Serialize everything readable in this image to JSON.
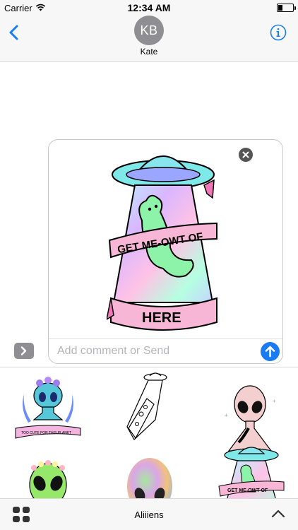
{
  "status": {
    "carrier": "Carrier",
    "time": "12:34 AM"
  },
  "header": {
    "avatar_initials": "KB",
    "contact_name": "Kate"
  },
  "preview": {
    "sticker_text_top": "GET ME-OWT OF",
    "sticker_text_bottom": "HERE",
    "comment_placeholder": "Add comment or Send"
  },
  "drawer": {
    "stickers": [
      {
        "name": "alien-bust-sticker",
        "caption": "TOO CUTE FOR THIS PLANET"
      },
      {
        "name": "ufo-pizza-sticker"
      },
      {
        "name": "pink-alien-sticker"
      },
      {
        "name": "green-alien-flower-crown-sticker"
      },
      {
        "name": "rainbow-alien-sticker"
      },
      {
        "name": "ufo-cat-sticker",
        "caption": "GET ME-OWT OF"
      }
    ]
  },
  "bottom_bar": {
    "pack_name": "Aliiiens"
  },
  "colors": {
    "accent": "#1a7cf5",
    "bar_bg": "#f7f7f7",
    "avatar_bg": "#8e8e93",
    "placeholder": "#b5b5ba"
  },
  "icons": [
    "wifi-icon",
    "battery-icon",
    "back-chevron-icon",
    "info-icon",
    "close-icon",
    "send-arrow-icon",
    "expand-arrow-icon",
    "apps-grid-icon",
    "chevron-up-icon"
  ]
}
